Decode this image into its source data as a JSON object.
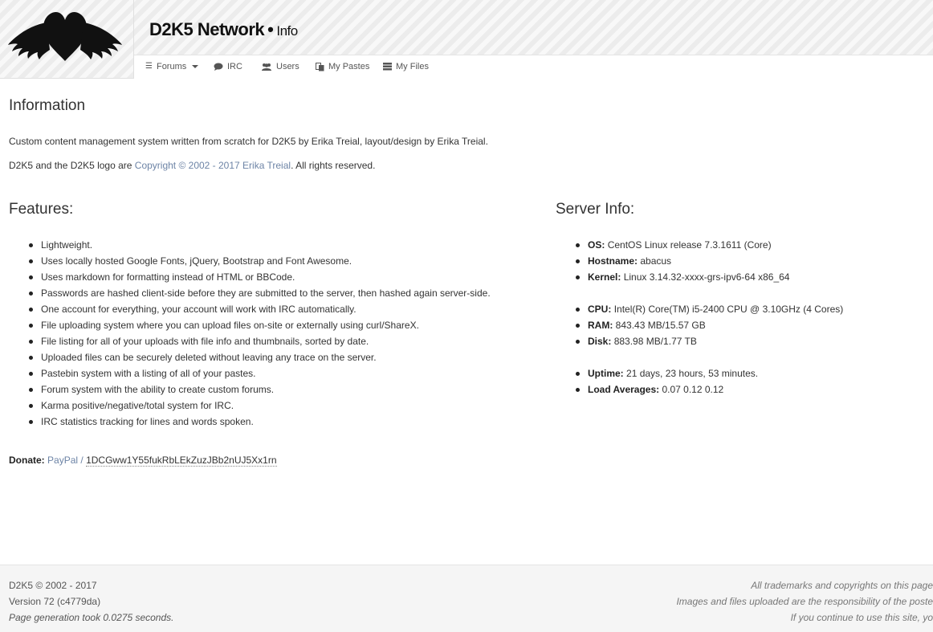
{
  "header": {
    "site_name": "D2K5 Network",
    "separator": "•",
    "page_name": "Info"
  },
  "nav": {
    "forums": "Forums",
    "irc": "IRC",
    "users": "Users",
    "pastes": "My Pastes",
    "files": "My Files"
  },
  "info": {
    "title": "Information",
    "line1": "Custom content management system written from scratch for D2K5 by Erika Treial, layout/design by Erika Treial.",
    "line2_prefix": "D2K5 and the D2K5 logo are ",
    "line2_link": "Copyright © 2002 - 2017 Erika Treial",
    "line2_suffix": ". All rights reserved."
  },
  "features": {
    "title": "Features:",
    "items": [
      "Lightweight.",
      "Uses locally hosted Google Fonts, jQuery, Bootstrap and Font Awesome.",
      "Uses markdown for formatting instead of HTML or BBCode.",
      "Passwords are hashed client-side before they are submitted to the server, then hashed again server-side.",
      "One account for everything, your account will work with IRC automatically.",
      "File uploading system where you can upload files on-site or externally using curl/ShareX.",
      "File listing for all of your uploads with file info and thumbnails, sorted by date.",
      "Uploaded files can be securely deleted without leaving any trace on the server.",
      "Pastebin system with a listing of all of your pastes.",
      "Forum system with the ability to create custom forums.",
      "Karma positive/negative/total system for IRC.",
      "IRC statistics tracking for lines and words spoken."
    ]
  },
  "server": {
    "title": "Server Info:",
    "os_label": "OS:",
    "os": "CentOS Linux release 7.3.1611 (Core)",
    "hostname_label": "Hostname:",
    "hostname": "abacus",
    "kernel_label": "Kernel:",
    "kernel": "Linux 3.14.32-xxxx-grs-ipv6-64 x86_64",
    "cpu_label": "CPU:",
    "cpu": "Intel(R) Core(TM) i5-2400 CPU @ 3.10GHz (4 Cores)",
    "ram_label": "RAM:",
    "ram": "843.43 MB/15.57 GB",
    "disk_label": "Disk:",
    "disk": "883.98 MB/1.77 TB",
    "uptime_label": "Uptime:",
    "uptime": "21 days, 23 hours, 53 minutes.",
    "load_label": "Load Averages:",
    "load": "0.07 0.12 0.12"
  },
  "donate": {
    "label": "Donate:",
    "paypal": "PayPal",
    "sep": "/",
    "btc": "1DCGww1Y55fukRbLEkZuzJBb2nUJ5Xx1rn"
  },
  "footer": {
    "copyright": "D2K5 © 2002 - 2017",
    "version": "Version 72 (c4779da)",
    "generation": "Page generation took 0.0275 seconds.",
    "right1": "All trademarks and copyrights on this page",
    "right2": "Images and files uploaded are the responsibility of the poste",
    "right3": "If you continue to use this site, yo"
  }
}
